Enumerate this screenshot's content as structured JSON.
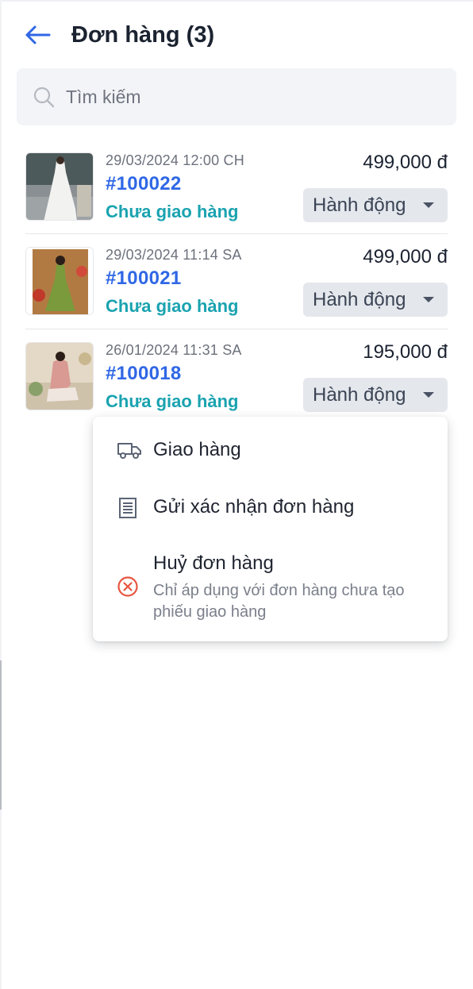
{
  "header": {
    "title": "Đơn hàng (3)",
    "back_icon": "arrow-left-icon"
  },
  "search": {
    "placeholder": "Tìm kiếm",
    "value": "",
    "icon": "search-icon"
  },
  "orders": [
    {
      "datetime": "29/03/2024 12:00 CH",
      "id": "#100022",
      "status": "Chưa giao hàng",
      "amount": "499,000 đ",
      "action_label": "Hành động"
    },
    {
      "datetime": "29/03/2024 11:14 SA",
      "id": "#100021",
      "status": "Chưa giao hàng",
      "amount": "499,000 đ",
      "action_label": "Hành động"
    },
    {
      "datetime": "26/01/2024 11:31 SA",
      "id": "#100018",
      "status": "Chưa giao hàng",
      "amount": "195,000 đ",
      "action_label": "Hành động"
    }
  ],
  "action_menu": {
    "items": [
      {
        "label": "Giao hàng",
        "icon": "truck-icon"
      },
      {
        "label": "Gửi xác nhận đơn hàng",
        "icon": "receipt-icon"
      },
      {
        "label": "Huỷ đơn hàng",
        "sublabel": "Chỉ áp dụng với đơn hàng chưa tạo phiếu giao hàng",
        "icon": "cancel-circle-icon"
      }
    ]
  },
  "colors": {
    "accent_blue": "#2f67e6",
    "status_teal": "#1aa3b0",
    "cancel_red": "#e8553f",
    "action_bg": "#e4e7ec"
  }
}
